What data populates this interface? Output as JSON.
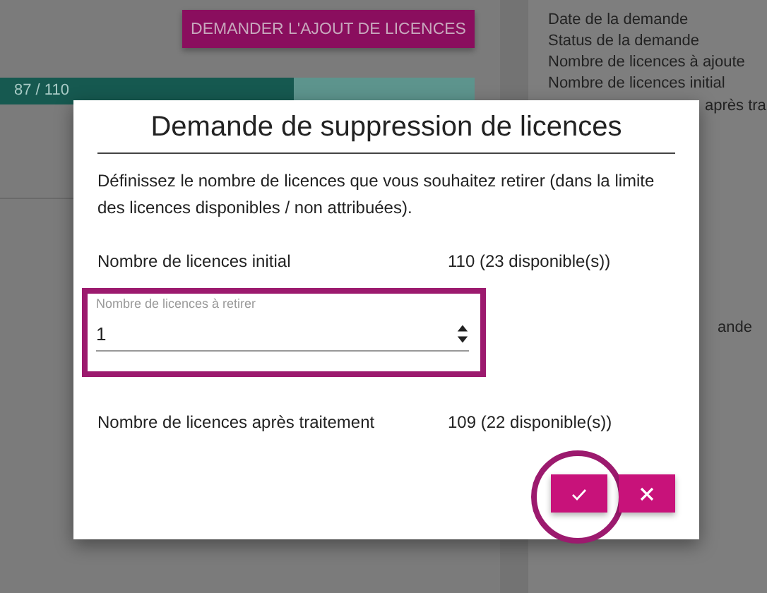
{
  "background": {
    "add_button": "DEMANDER L'AJOUT DE LICENCES",
    "usage": {
      "reading": "87 / 110",
      "level": 0.62
    },
    "details": [
      "Date de la demande",
      "Status de la demande",
      "Nombre de licences à ajoute",
      "Nombre de licences initial"
    ],
    "details_cut": "après tra",
    "right_fragment": "ande"
  },
  "dialog": {
    "title": "Demande de suppression de licences",
    "description": "Définissez le nombre de licences que vous souhaitez retirer (dans la limite des licences disponibles / non attribuées).",
    "rows": [
      {
        "label": "Nombre de licences initial",
        "value": "110 (23 disponible(s))"
      }
    ],
    "field": {
      "label": "Nombre de licences à retirer",
      "value": "1"
    },
    "result": {
      "label": "Nombre de licences après traitement",
      "value": "109 (22 disponible(s))"
    },
    "confirm_ringed": true,
    "buttons": [
      {
        "kind": "confirm"
      },
      {
        "kind": "cancel"
      }
    ]
  }
}
